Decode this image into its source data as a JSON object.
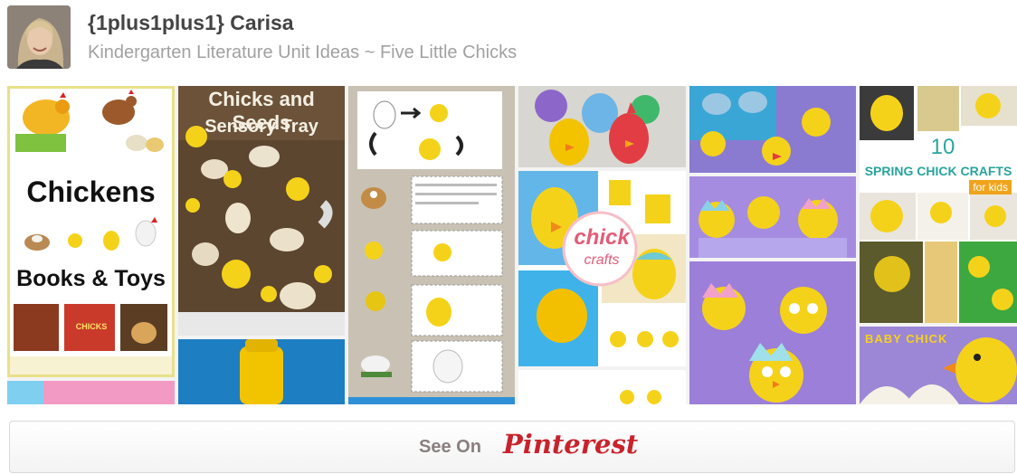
{
  "header": {
    "username": "{1plus1plus1} Carisa",
    "board_title": "Kindergarten Literature Unit Ideas ~ Five Little Chicks"
  },
  "pins": {
    "chickens_books": {
      "title": "Chickens",
      "subtitle": "Books & Toys",
      "book_label": "CHICKS"
    },
    "sensory_tray": {
      "title": "Chicks and Seeds",
      "subtitle": "Sensory Tray"
    },
    "chick_crafts": {
      "line1": "chick",
      "line2": "crafts"
    },
    "spring_crafts": {
      "number": "10",
      "title": "SPRING CHICK CRAFTS",
      "subtitle": "for kids"
    },
    "baby_chick": {
      "title": "BABY CHICK"
    }
  },
  "footer": {
    "see_on": "See On",
    "logo": "Pinterest"
  },
  "colors": {
    "accent": "#c8232c",
    "chick_yellow": "#f5d21a",
    "header_text": "#444444",
    "subtle_text": "#a1a1a1"
  }
}
